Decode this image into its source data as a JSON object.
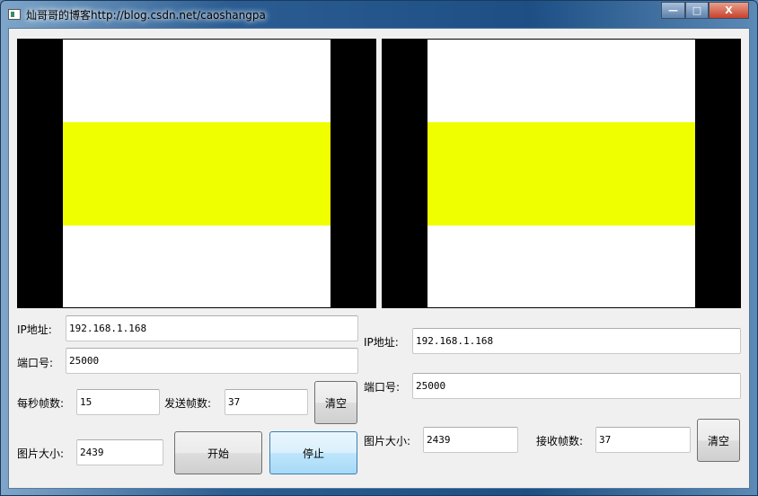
{
  "window": {
    "title": "灿哥哥的博客http://blog.csdn.net/caoshangpa",
    "minimize": "—",
    "maximize": "□",
    "close": "X"
  },
  "sender": {
    "ip_label": "IP地址:",
    "ip_value": "192.168.1.168",
    "port_label": "端口号:",
    "port_value": "25000",
    "fps_label": "每秒帧数:",
    "fps_value": "15",
    "sent_label": "发送帧数:",
    "sent_value": "37",
    "clear_label": "清空",
    "size_label": "图片大小:",
    "size_value": "2439",
    "start_label": "开始",
    "stop_label": "停止"
  },
  "receiver": {
    "ip_label": "IP地址:",
    "ip_value": "192.168.1.168",
    "port_label": "端口号:",
    "port_value": "25000",
    "size_label": "图片大小:",
    "size_value": "2439",
    "recv_label": "接收帧数:",
    "recv_value": "37",
    "clear_label": "清空"
  },
  "colors": {
    "stripe": "#f0ff00"
  }
}
